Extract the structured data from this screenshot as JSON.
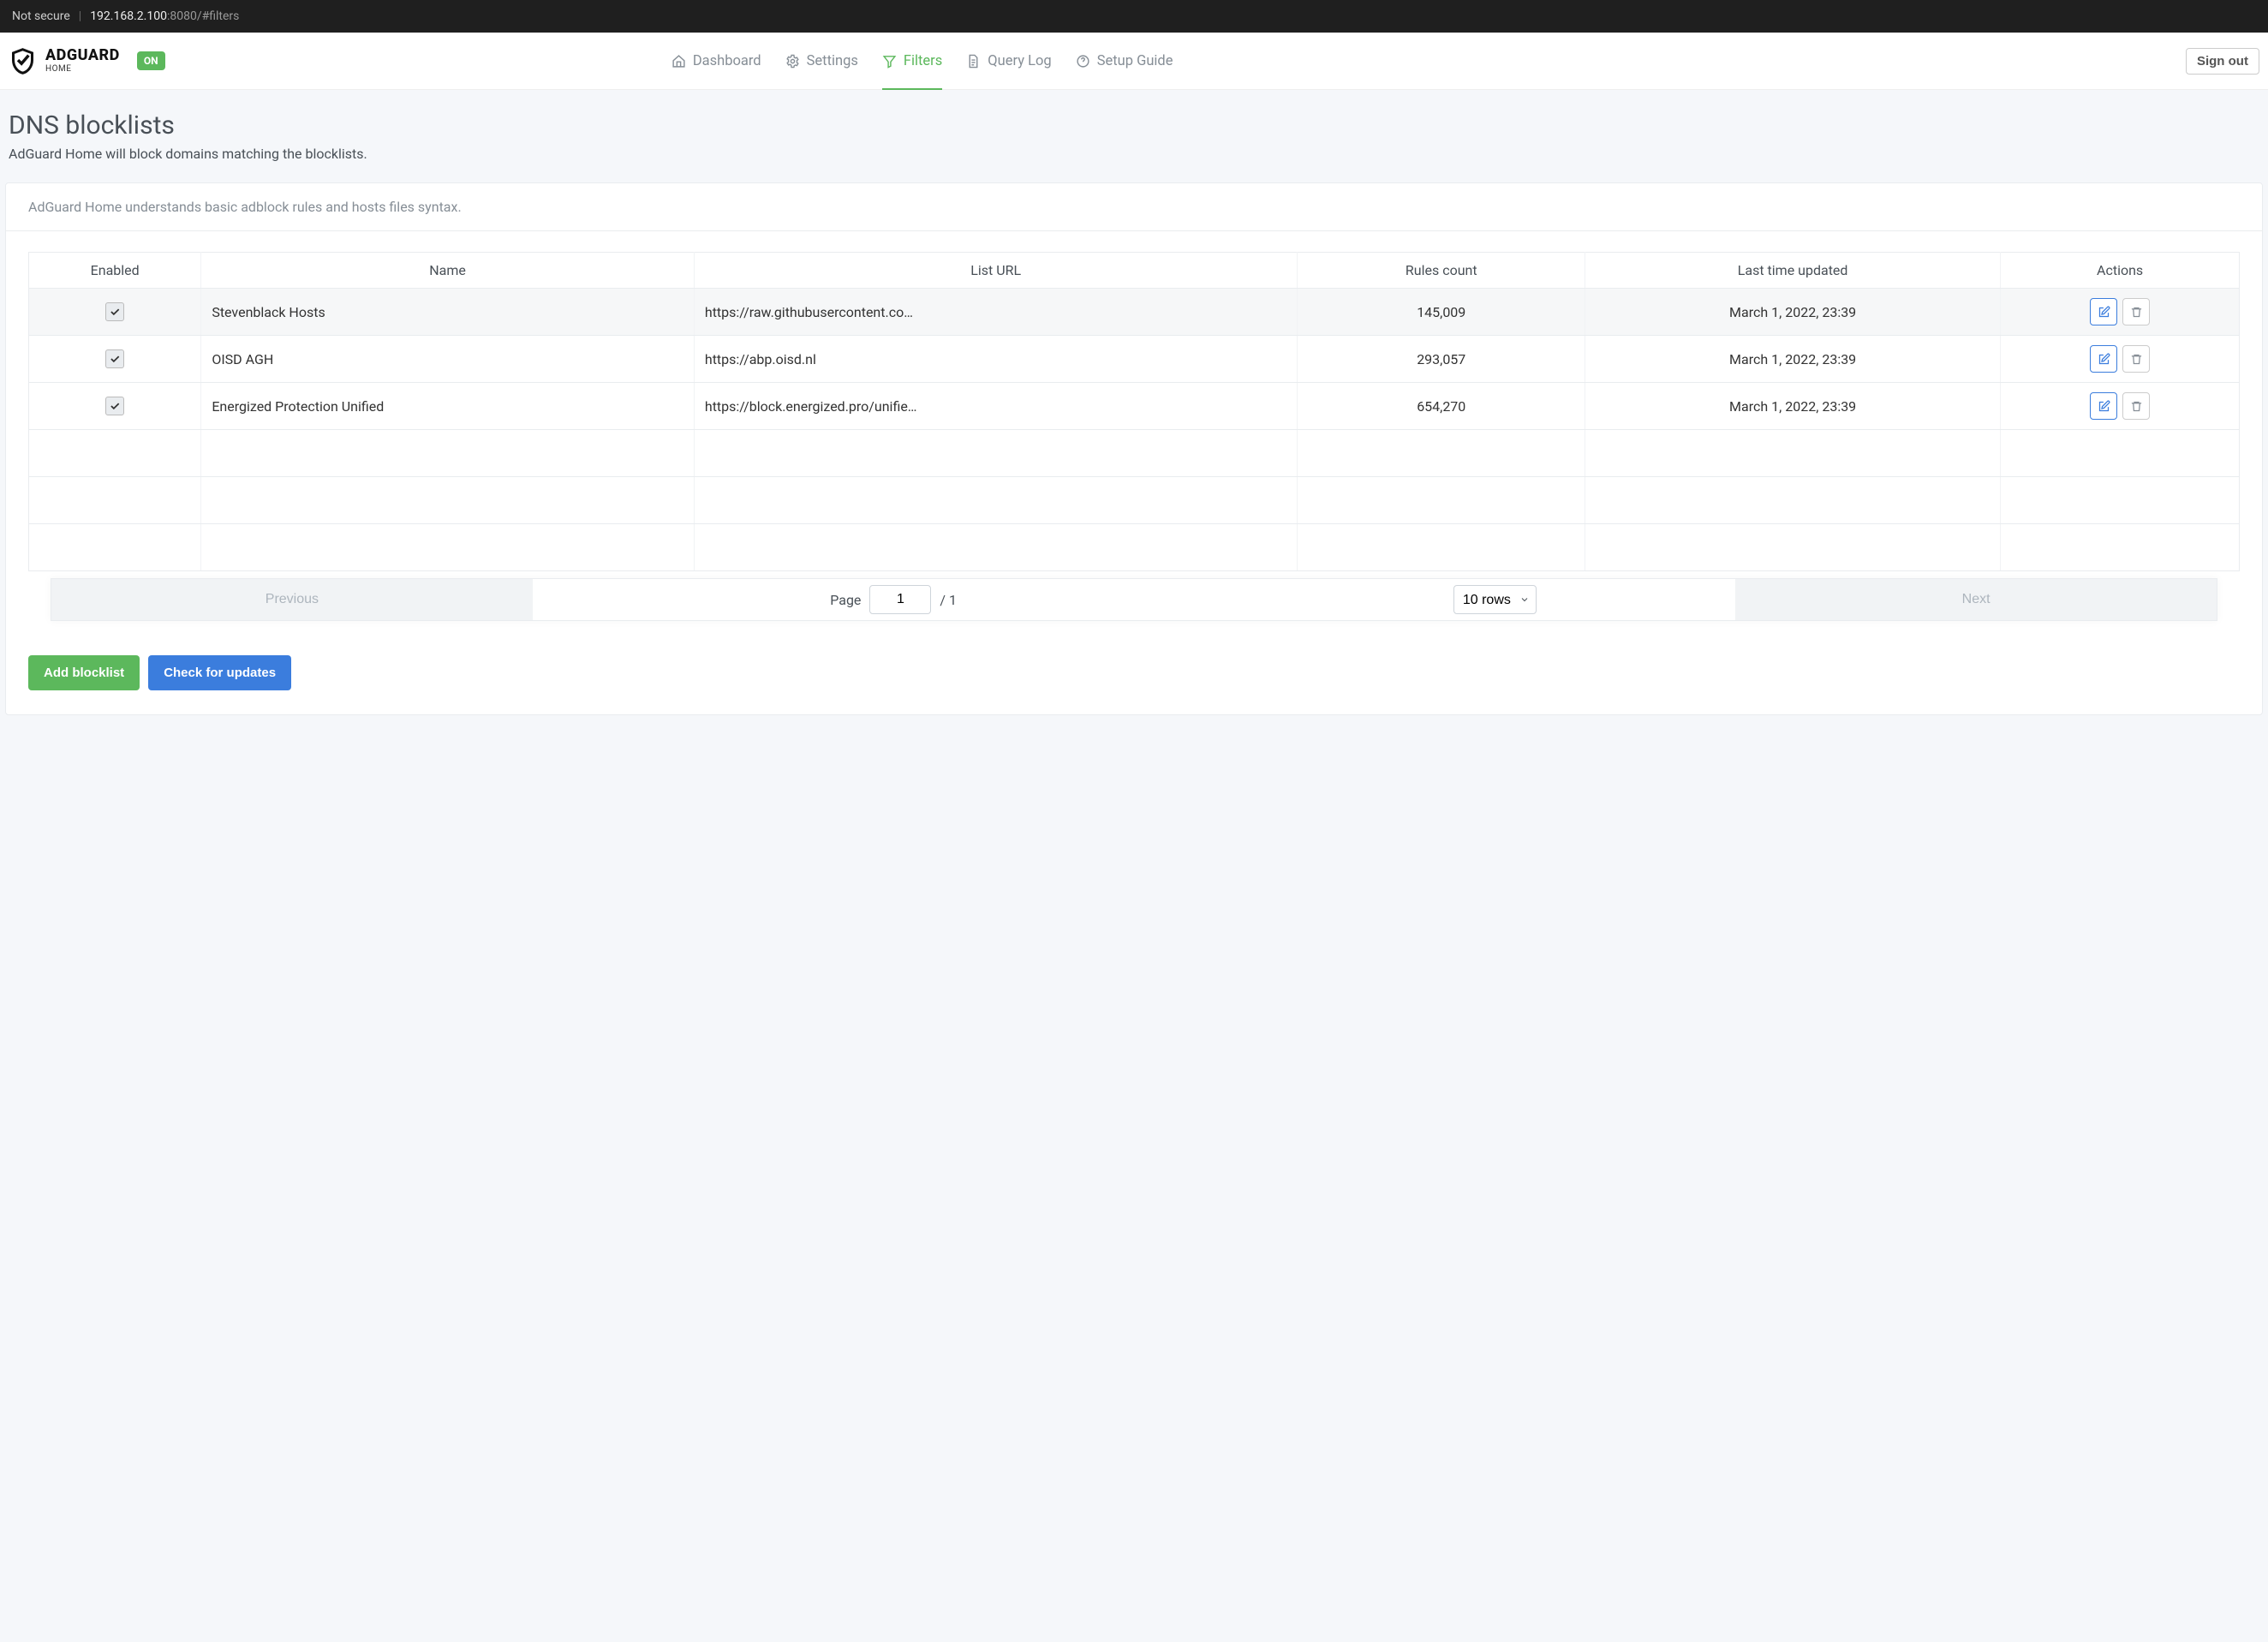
{
  "browser": {
    "security": "Not secure",
    "url_host": "192.168.2.100",
    "url_rest": ":8080/#filters"
  },
  "brand": {
    "top": "ADGUARD",
    "bottom": "HOME",
    "status": "ON"
  },
  "nav": {
    "dashboard": "Dashboard",
    "settings": "Settings",
    "filters": "Filters",
    "querylog": "Query Log",
    "setupguide": "Setup Guide"
  },
  "sign_out": "Sign out",
  "page": {
    "title": "DNS blocklists",
    "subtitle": "AdGuard Home will block domains matching the blocklists.",
    "note": "AdGuard Home understands basic adblock rules and hosts files syntax."
  },
  "table": {
    "headers": {
      "enabled": "Enabled",
      "name": "Name",
      "url": "List URL",
      "rules": "Rules count",
      "updated": "Last time updated",
      "actions": "Actions"
    },
    "rows": [
      {
        "enabled": true,
        "name": "Stevenblack Hosts",
        "url": "https://raw.githubusercontent.co…",
        "rules": "145,009",
        "updated": "March 1, 2022, 23:39"
      },
      {
        "enabled": true,
        "name": "OISD AGH",
        "url": "https://abp.oisd.nl",
        "rules": "293,057",
        "updated": "March 1, 2022, 23:39"
      },
      {
        "enabled": true,
        "name": "Energized Protection Unified",
        "url": "https://block.energized.pro/unifie…",
        "rules": "654,270",
        "updated": "March 1, 2022, 23:39"
      }
    ]
  },
  "pager": {
    "prev": "Previous",
    "next": "Next",
    "page_label": "Page",
    "page_value": "1",
    "page_total": "/ 1",
    "rows_option": "10 rows"
  },
  "buttons": {
    "add": "Add blocklist",
    "check": "Check for updates"
  }
}
